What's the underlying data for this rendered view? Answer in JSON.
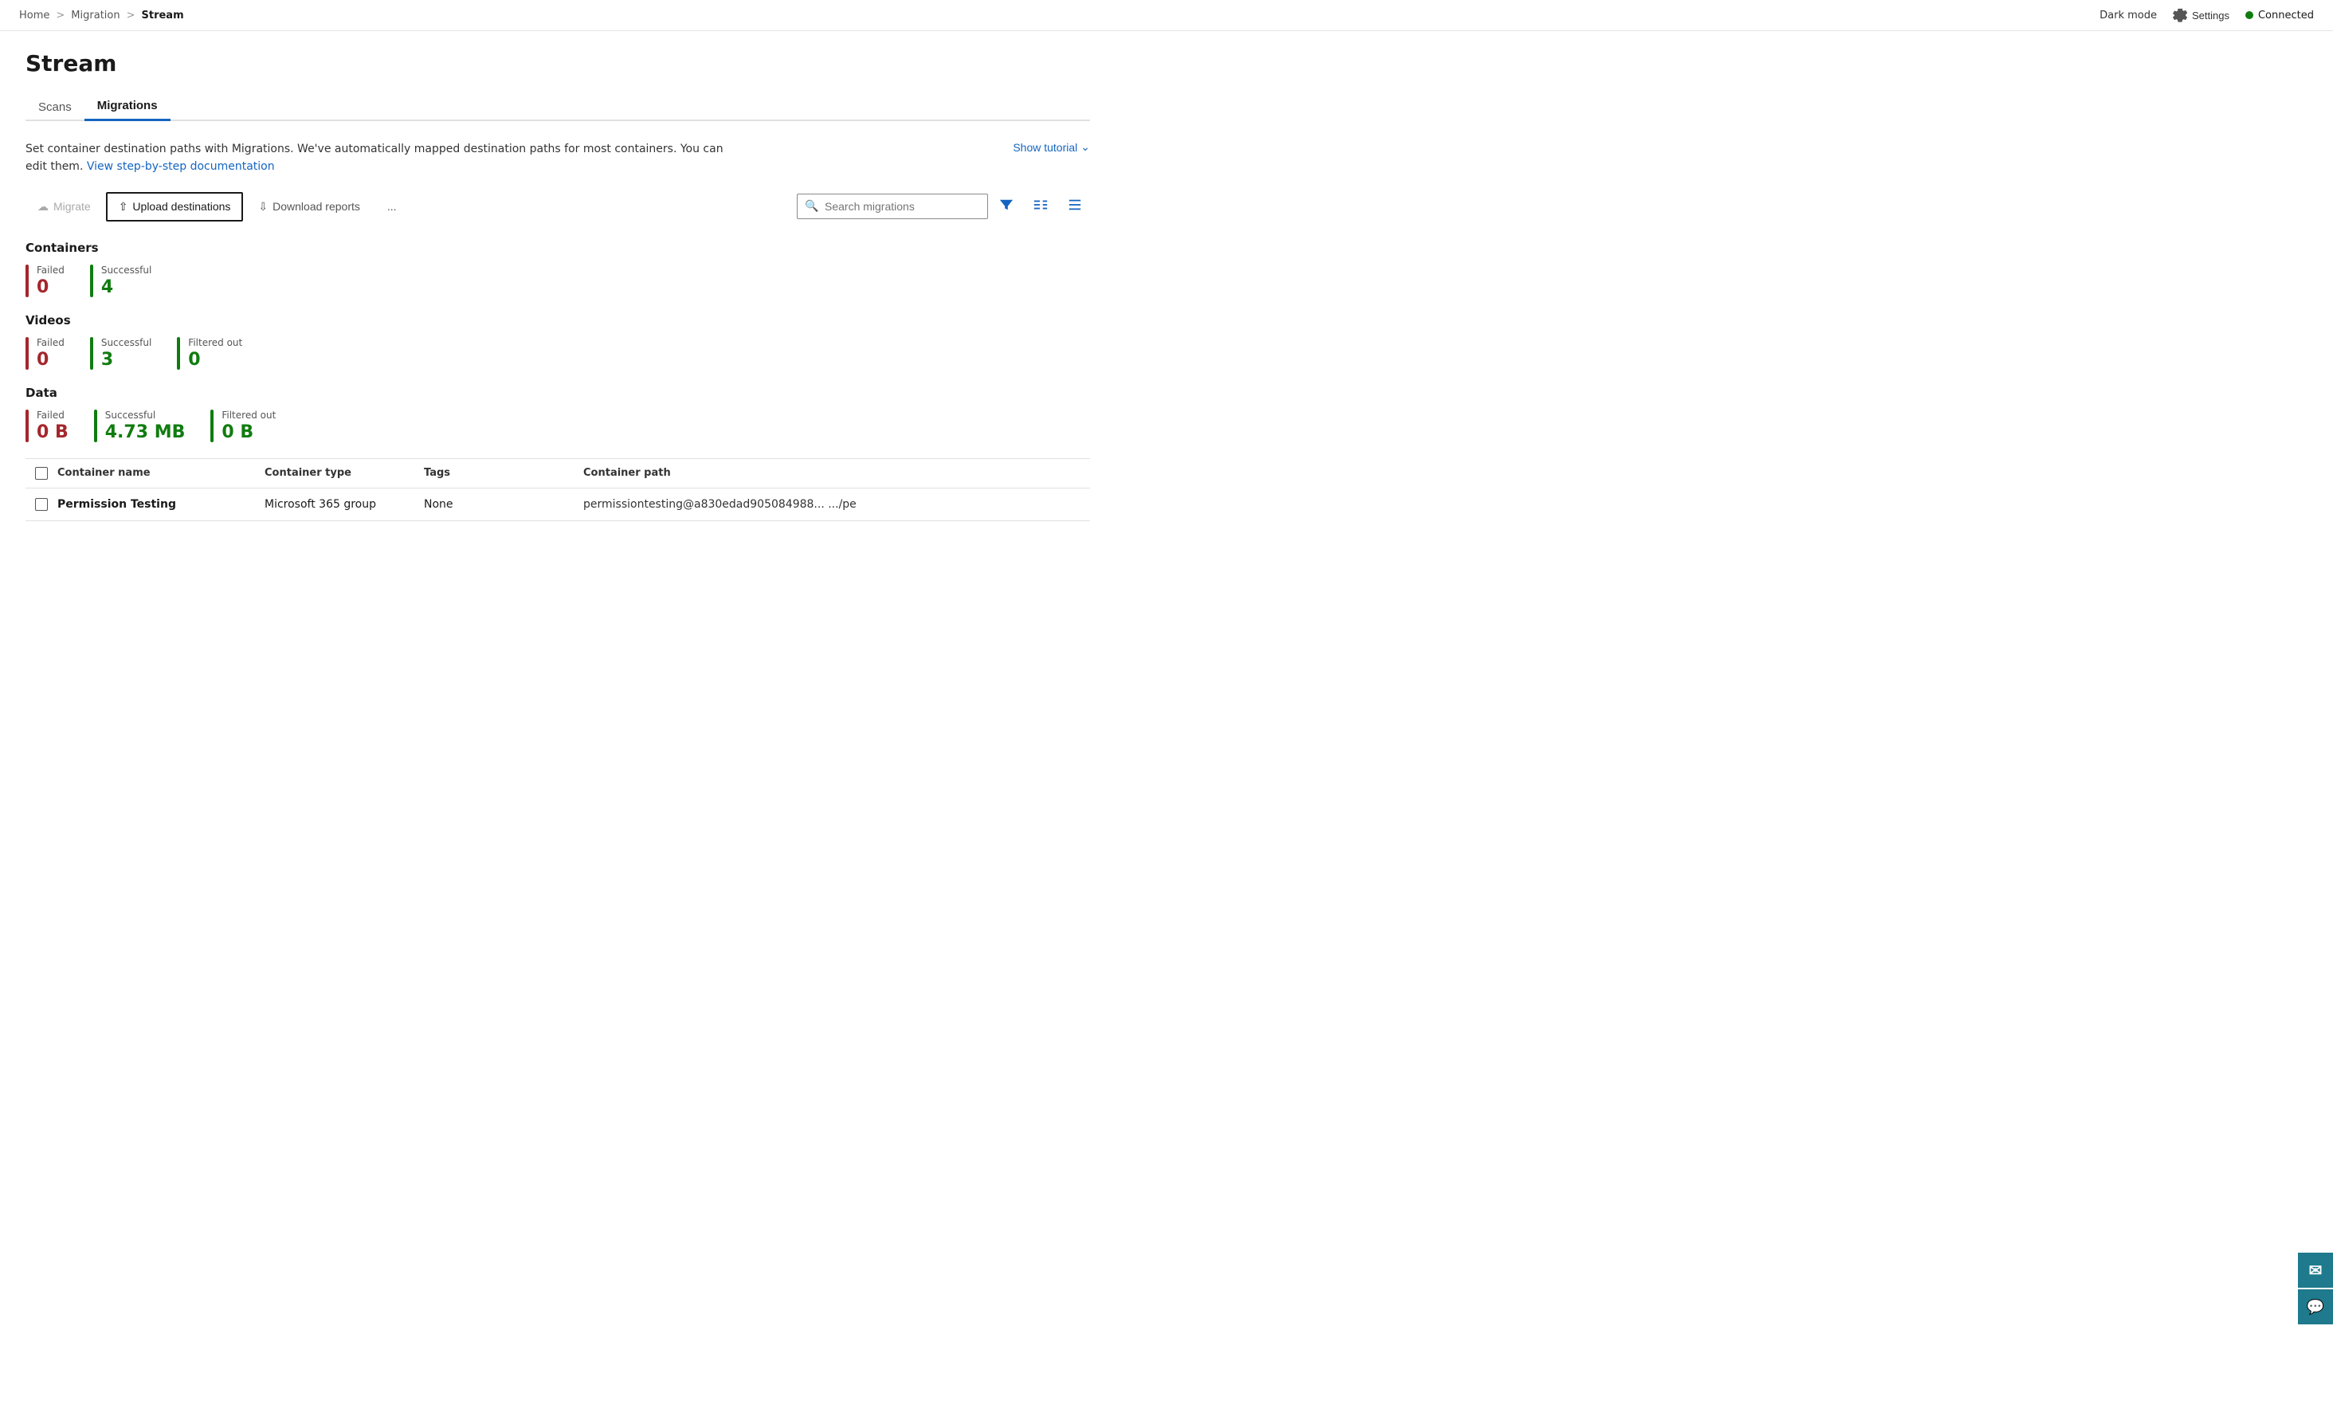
{
  "breadcrumb": {
    "home": "Home",
    "migration": "Migration",
    "current": "Stream",
    "sep1": ">",
    "sep2": ">"
  },
  "topbar": {
    "darkmode_label": "Dark mode",
    "settings_label": "Settings",
    "connected_label": "Connected"
  },
  "page": {
    "title": "Stream"
  },
  "tabs": [
    {
      "id": "scans",
      "label": "Scans",
      "active": false
    },
    {
      "id": "migrations",
      "label": "Migrations",
      "active": true
    }
  ],
  "description": {
    "text": "Set container destination paths with Migrations. We've automatically mapped destination paths for most containers. You can edit them.",
    "link_text": "View step-by-step documentation",
    "show_tutorial": "Show tutorial"
  },
  "toolbar": {
    "migrate_label": "Migrate",
    "upload_label": "Upload destinations",
    "download_label": "Download reports",
    "more_label": "...",
    "search_placeholder": "Search migrations"
  },
  "stats": {
    "containers": {
      "title": "Containers",
      "failed_label": "Failed",
      "failed_value": "0",
      "successful_label": "Successful",
      "successful_value": "4"
    },
    "videos": {
      "title": "Videos",
      "failed_label": "Failed",
      "failed_value": "0",
      "successful_label": "Successful",
      "successful_value": "3",
      "filtered_label": "Filtered out",
      "filtered_value": "0"
    },
    "data": {
      "title": "Data",
      "failed_label": "Failed",
      "failed_value": "0 B",
      "successful_label": "Successful",
      "successful_value": "4.73 MB",
      "filtered_label": "Filtered out",
      "filtered_value": "0 B"
    }
  },
  "table": {
    "headers": [
      {
        "key": "checkbox",
        "label": ""
      },
      {
        "key": "container_name",
        "label": "Container name"
      },
      {
        "key": "container_type",
        "label": "Container type"
      },
      {
        "key": "tags",
        "label": "Tags"
      },
      {
        "key": "container_path",
        "label": "Container path"
      }
    ],
    "rows": [
      {
        "container_name": "Permission Testing",
        "container_type": "Microsoft 365 group",
        "tags": "None",
        "container_path": "permissiontesting@a830edad905084988...   .../pe"
      }
    ]
  },
  "sidebar_buttons": [
    {
      "id": "help",
      "icon": "?"
    },
    {
      "id": "chat",
      "icon": "💬"
    }
  ]
}
